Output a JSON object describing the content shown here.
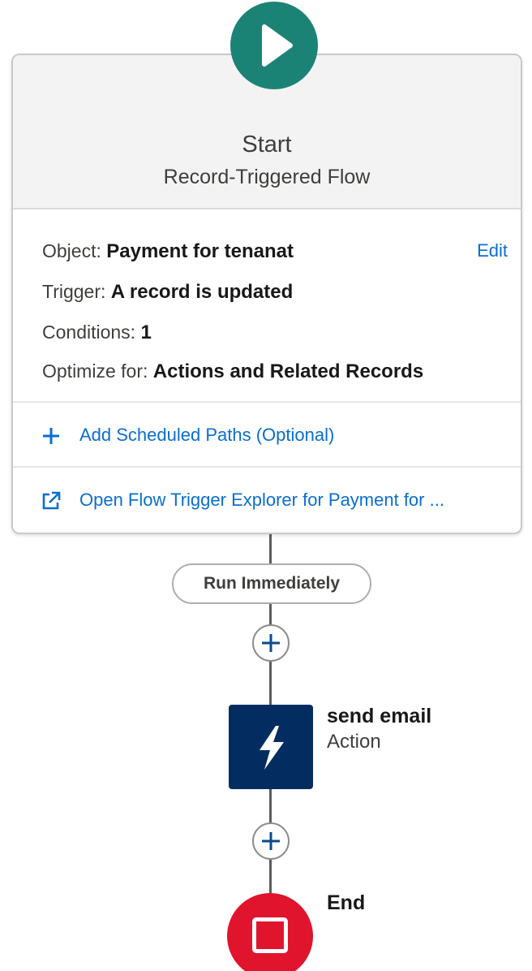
{
  "start": {
    "title": "Start",
    "subtitle": "Record-Triggered Flow",
    "icon": "play-icon",
    "color": "#1b8376"
  },
  "details": {
    "object_label": "Object:",
    "object_value": "Payment for tenanat",
    "edit_label": "Edit",
    "trigger_label": "Trigger:",
    "trigger_value": "A record is updated",
    "conditions_label": "Conditions:",
    "conditions_value": "1",
    "optimize_label": "Optimize for:",
    "optimize_value": "Actions and Related Records"
  },
  "links": {
    "scheduled_paths": "Add Scheduled Paths (Optional)",
    "scheduled_icon": "plus-icon",
    "trigger_explorer": "Open Flow Trigger Explorer for Payment for ...",
    "explorer_icon": "external-link-icon"
  },
  "path": {
    "run_label": "Run Immediately"
  },
  "action": {
    "name": "send email",
    "type": "Action",
    "icon": "lightning-bolt-icon",
    "color": "#032d60"
  },
  "end": {
    "label": "End",
    "icon": "stop-icon",
    "color": "#e1142e"
  },
  "colors": {
    "link": "#0b6ed0",
    "connector": "#5c5c5c"
  }
}
